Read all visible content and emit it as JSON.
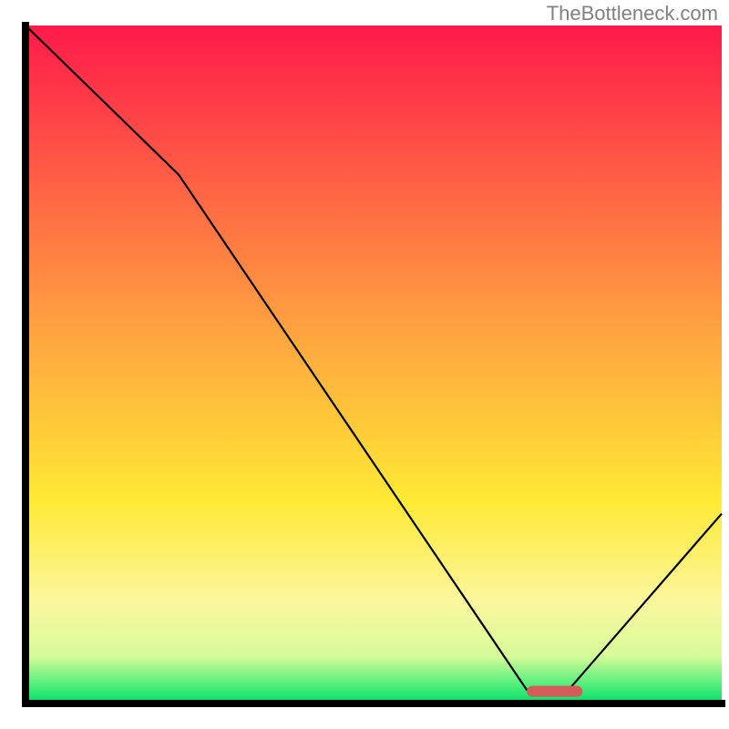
{
  "attribution": "TheBottleneck.com",
  "chart_data": {
    "type": "line",
    "title": "",
    "xlabel": "",
    "ylabel": "",
    "xlim": [
      0,
      100
    ],
    "ylim": [
      0,
      100
    ],
    "grid": false,
    "axes_visible": false,
    "background_gradient": [
      {
        "pos": 0.0,
        "color": "#ff1a4a"
      },
      {
        "pos": 0.45,
        "color": "#ffa340"
      },
      {
        "pos": 0.7,
        "color": "#ffe934"
      },
      {
        "pos": 0.85,
        "color": "#fbf79e"
      },
      {
        "pos": 0.93,
        "color": "#d7fb99"
      },
      {
        "pos": 0.97,
        "color": "#59f07e"
      },
      {
        "pos": 1.0,
        "color": "#00dd66"
      }
    ],
    "curve": {
      "name": "bottleneck-curve",
      "x": [
        0,
        22,
        72,
        78,
        100
      ],
      "y": [
        100,
        78,
        2,
        2,
        28
      ]
    },
    "optimal_marker": {
      "x_start": 72,
      "x_end": 80,
      "y": 1.8,
      "color": "#d65a5a"
    },
    "frame_color": "#000000",
    "frame_width": 2
  }
}
